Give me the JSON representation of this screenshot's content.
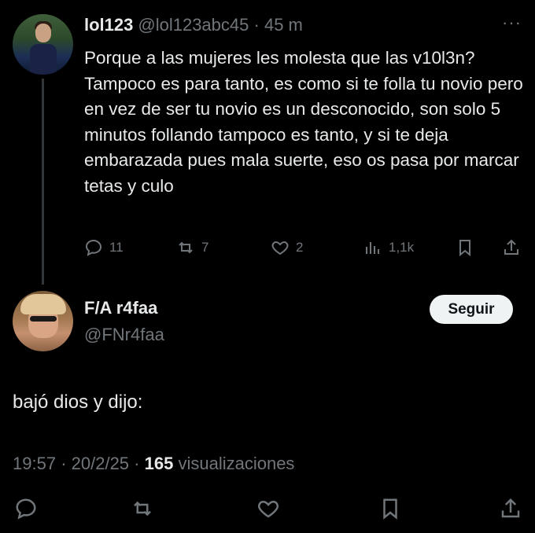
{
  "tweet1": {
    "name": "lol123",
    "handle": "@lol123abc45",
    "separator": "·",
    "time": "45 m",
    "more": "···",
    "text": "Porque a las mujeres les molesta que las v10l3n? Tampoco es para tanto, es como si te folla tu novio pero en vez de ser tu novio es un desconocido, son solo 5 minutos follando tampoco es tanto, y si te deja embarazada pues mala suerte, eso os pasa por marcar tetas y culo",
    "replies": "11",
    "retweets": "7",
    "likes": "2",
    "views": "1,1k"
  },
  "tweet2": {
    "name": "F/A r4faa",
    "handle": "@FNr4faa",
    "follow_label": "Seguir",
    "text": "bajó dios y dijo:",
    "time": "19:57",
    "sep1": "·",
    "date": "20/2/25",
    "sep2": "·",
    "views_count": "165",
    "views_label": "visualizaciones"
  },
  "colors": {
    "background": "#000000",
    "text": "#e7e9ea",
    "muted": "#71767b",
    "button_bg": "#eff3f4"
  },
  "icons": [
    "reply-icon",
    "retweet-icon",
    "like-icon",
    "views-icon",
    "bookmark-icon",
    "share-icon",
    "more-icon"
  ]
}
